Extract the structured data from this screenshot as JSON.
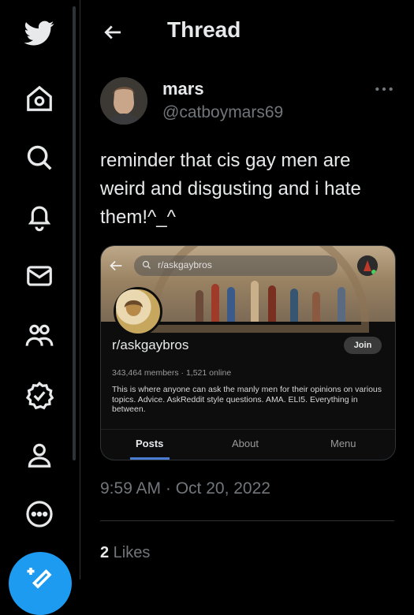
{
  "colors": {
    "accent": "#1d9bf0",
    "text": "#e7e9ea",
    "muted": "#71767b",
    "border": "#2f3336"
  },
  "sidebar": {
    "icons": [
      "twitter-logo-icon",
      "home-icon",
      "search-icon",
      "notifications-bell-icon",
      "messages-envelope-icon",
      "communities-icon",
      "verified-badge-icon",
      "profile-person-icon",
      "more-circle-icon",
      "compose-icon"
    ]
  },
  "header": {
    "title": "Thread"
  },
  "tweet": {
    "name": "mars",
    "handle": "@catboymars69",
    "text": "reminder that cis gay men are weird and disgusting and i hate them!^_^",
    "timestamp": "9:59 AM · Oct 20, 2022",
    "likes_count": "2",
    "likes_label": " Likes"
  },
  "media": {
    "search_text": "r/askgaybros",
    "subreddit_name": "r/askgaybros",
    "join_label": "Join",
    "members": "343,464 members · 1,521 online",
    "description": "This is where anyone can ask the manly men for their opinions on various topics. Advice. AskReddit style questions. AMA. ELI5. Everything in between.",
    "tabs": [
      {
        "label": "Posts"
      },
      {
        "label": "About"
      },
      {
        "label": "Menu"
      }
    ]
  }
}
